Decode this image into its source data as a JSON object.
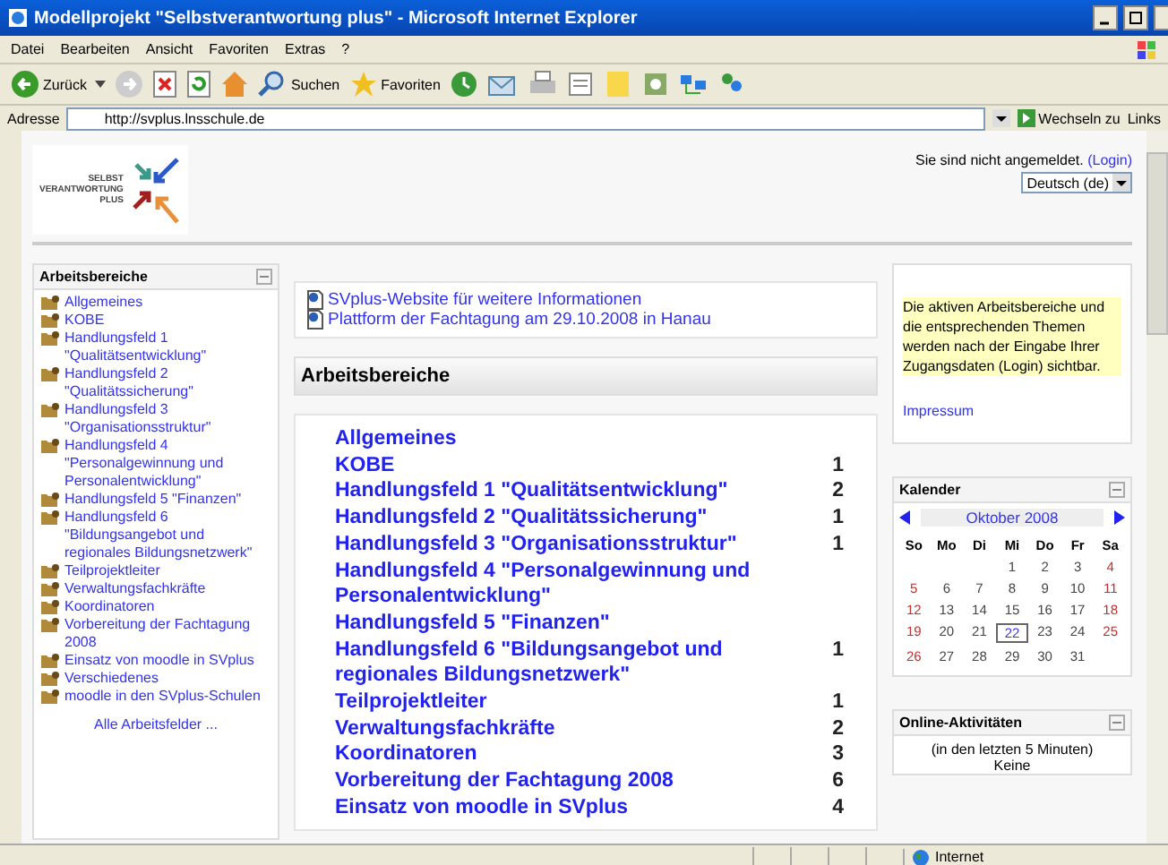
{
  "window": {
    "title": "Modellprojekt \"Selbstverantwortung plus\" - Microsoft Internet Explorer"
  },
  "menu": [
    "Datei",
    "Bearbeiten",
    "Ansicht",
    "Favoriten",
    "Extras",
    "?"
  ],
  "toolbar": {
    "back": "Zurück",
    "search": "Suchen",
    "favorites": "Favoriten"
  },
  "address": {
    "label": "Adresse",
    "value": "http://svplus.lnsschule.de",
    "go": "Wechseln zu",
    "links": "Links"
  },
  "logo": {
    "lines": [
      "SELBST",
      "VERANTWORTUNG",
      "PLUS"
    ]
  },
  "login": {
    "text": "Sie sind nicht angemeldet.",
    "link": "(Login)",
    "language": "Deutsch (de)"
  },
  "sidebar": {
    "title": "Arbeitsbereiche",
    "items": [
      {
        "label": "Allgemeines"
      },
      {
        "label": "KOBE"
      },
      {
        "label": "Handlungsfeld 1 \"Qualitätsentwicklung\""
      },
      {
        "label": "Handlungsfeld 2 \"Qualitätssicherung\""
      },
      {
        "label": "Handlungsfeld 3 \"Organisationsstruktur\""
      },
      {
        "label": "Handlungsfeld 4 \"Personalgewinnung und Personalentwicklung\""
      },
      {
        "label": "Handlungsfeld 5 \"Finanzen\""
      },
      {
        "label": "Handlungsfeld 6 \"Bildungsangebot und regionales Bildungsnetzwerk\""
      },
      {
        "label": "Teilprojektleiter"
      },
      {
        "label": "Verwaltungsfachkräfte"
      },
      {
        "label": "Koordinatoren"
      },
      {
        "label": "Vorbereitung der Fachtagung 2008"
      },
      {
        "label": "Einsatz von moodle in SVplus"
      },
      {
        "label": "Verschiedenes"
      },
      {
        "label": "moodle in den SVplus-Schulen"
      }
    ],
    "footer": "Alle Arbeitsfelder ..."
  },
  "links": [
    "SVplus-Website für weitere Informationen",
    "Plattform der Fachtagung am 29.10.2008 in Hanau"
  ],
  "main": {
    "title": "Arbeitsbereiche",
    "rows": [
      {
        "name": "Allgemeines"
      },
      {
        "name": "KOBE",
        "count": "1"
      },
      {
        "name": "Handlungsfeld 1 \"Qualitätsentwicklung\"",
        "count": "2"
      },
      {
        "name": "Handlungsfeld 2 \"Qualitätssicherung\"",
        "count": "1"
      },
      {
        "name": "Handlungsfeld 3 \"Organisationsstruktur\"",
        "count": "1"
      },
      {
        "name": "Handlungsfeld 4 \"Personalgewinnung und Personalentwicklung\""
      },
      {
        "name": "Handlungsfeld 5 \"Finanzen\""
      },
      {
        "name": "Handlungsfeld 6 \"Bildungsangebot und regionales Bildungsnetzwerk\"",
        "count": "1"
      },
      {
        "name": "Teilprojektleiter",
        "count": "1"
      },
      {
        "name": "Verwaltungsfachkräfte",
        "count": "2"
      },
      {
        "name": "Koordinatoren",
        "count": "3"
      },
      {
        "name": "Vorbereitung der Fachtagung 2008",
        "count": "6"
      },
      {
        "name": "Einsatz von moodle in SVplus",
        "count": "4"
      }
    ]
  },
  "notice": {
    "text": "Die aktiven Arbeitsbereiche und die entsprechenden Themen werden nach der Eingabe Ihrer Zugangsdaten (Login) sichtbar.",
    "link": "Impressum"
  },
  "calendar": {
    "title": "Kalender",
    "month": "Oktober 2008",
    "weekdays": [
      "So",
      "Mo",
      "Di",
      "Mi",
      "Do",
      "Fr",
      "Sa"
    ],
    "days": [
      {
        "kind": "empty"
      },
      {
        "kind": "empty"
      },
      {
        "kind": "empty"
      },
      {
        "kind": "day",
        "text": "1",
        "weekend": false,
        "today": false
      },
      {
        "kind": "day",
        "text": "2",
        "weekend": false,
        "today": false
      },
      {
        "kind": "day",
        "text": "3",
        "weekend": false,
        "today": false
      },
      {
        "kind": "day",
        "text": "4",
        "weekend": true,
        "today": false
      },
      {
        "kind": "day",
        "text": "5",
        "weekend": true,
        "today": false
      },
      {
        "kind": "day",
        "text": "6",
        "weekend": false,
        "today": false
      },
      {
        "kind": "day",
        "text": "7",
        "weekend": false,
        "today": false
      },
      {
        "kind": "day",
        "text": "8",
        "weekend": false,
        "today": false
      },
      {
        "kind": "day",
        "text": "9",
        "weekend": false,
        "today": false
      },
      {
        "kind": "day",
        "text": "10",
        "weekend": false,
        "today": false
      },
      {
        "kind": "day",
        "text": "11",
        "weekend": true,
        "today": false
      },
      {
        "kind": "day",
        "text": "12",
        "weekend": true,
        "today": false
      },
      {
        "kind": "day",
        "text": "13",
        "weekend": false,
        "today": false
      },
      {
        "kind": "day",
        "text": "14",
        "weekend": false,
        "today": false
      },
      {
        "kind": "day",
        "text": "15",
        "weekend": false,
        "today": false
      },
      {
        "kind": "day",
        "text": "16",
        "weekend": false,
        "today": false
      },
      {
        "kind": "day",
        "text": "17",
        "weekend": false,
        "today": false
      },
      {
        "kind": "day",
        "text": "18",
        "weekend": true,
        "today": false
      },
      {
        "kind": "day",
        "text": "19",
        "weekend": true,
        "today": false
      },
      {
        "kind": "day",
        "text": "20",
        "weekend": false,
        "today": false
      },
      {
        "kind": "day",
        "text": "21",
        "weekend": false,
        "today": false
      },
      {
        "kind": "day",
        "text": "22",
        "weekend": false,
        "today": true
      },
      {
        "kind": "day",
        "text": "23",
        "weekend": false,
        "today": false
      },
      {
        "kind": "day",
        "text": "24",
        "weekend": false,
        "today": false
      },
      {
        "kind": "day",
        "text": "25",
        "weekend": true,
        "today": false
      },
      {
        "kind": "day",
        "text": "26",
        "weekend": true,
        "today": false
      },
      {
        "kind": "day",
        "text": "27",
        "weekend": false,
        "today": false
      },
      {
        "kind": "day",
        "text": "28",
        "weekend": false,
        "today": false
      },
      {
        "kind": "day",
        "text": "29",
        "weekend": false,
        "today": false
      },
      {
        "kind": "day",
        "text": "30",
        "weekend": false,
        "today": false
      },
      {
        "kind": "day",
        "text": "31",
        "weekend": false,
        "today": false
      }
    ]
  },
  "online": {
    "title": "Online-Aktivitäten",
    "period": "(in den letzten 5 Minuten)",
    "value": "Keine"
  },
  "status_bar": {
    "zone": "Internet"
  }
}
